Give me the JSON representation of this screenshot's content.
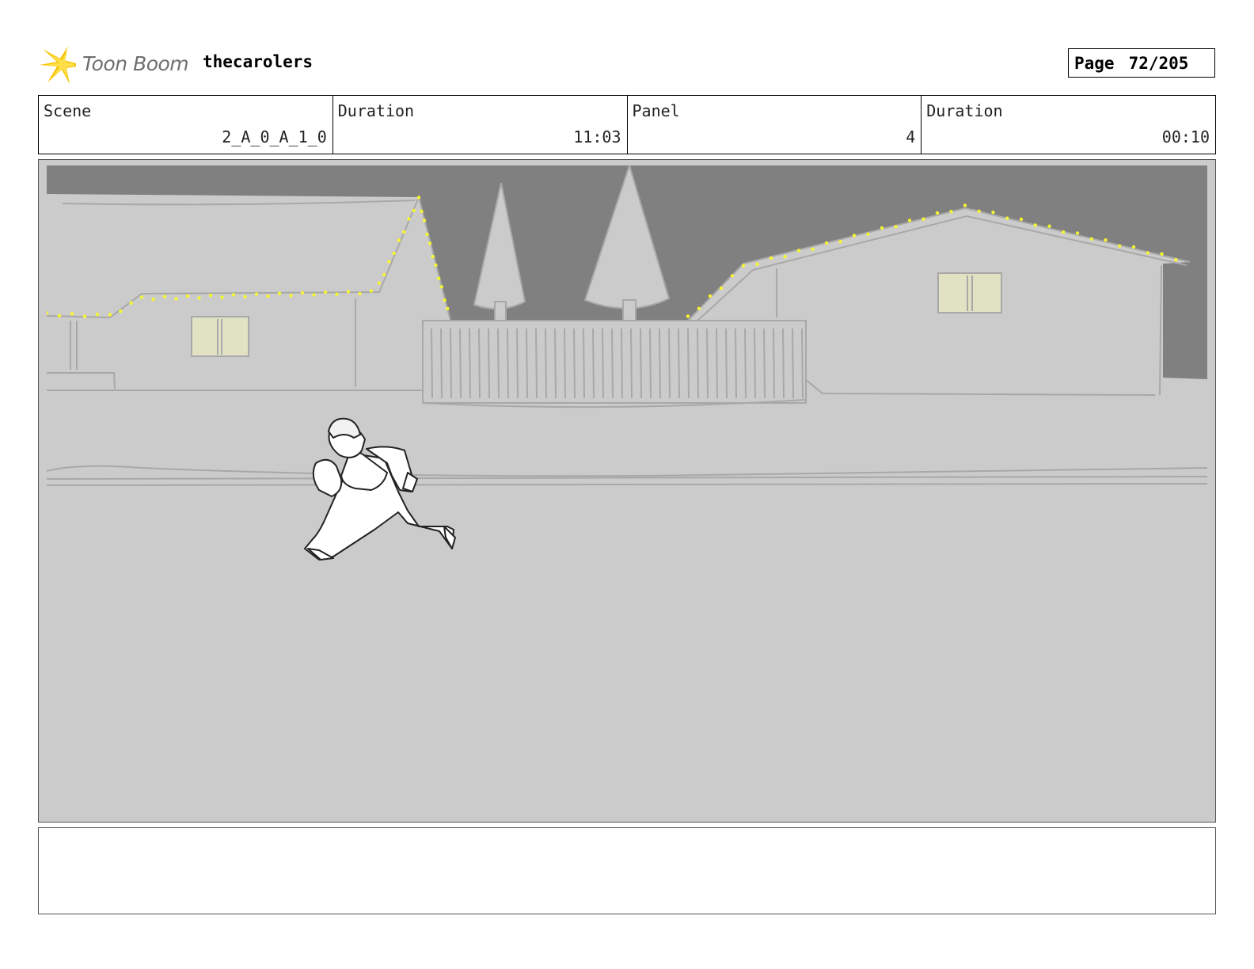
{
  "header": {
    "logo_text": "Toon Boom",
    "project_title": "thecarolers",
    "page_label": "Page",
    "page_number": "72/205"
  },
  "info": {
    "scene_label": "Scene",
    "scene_value": "2_A_0_A_1_0",
    "scene_duration_label": "Duration",
    "scene_duration_value": "11:03",
    "panel_label": "Panel",
    "panel_value": "4",
    "panel_duration_label": "Duration",
    "panel_duration_value": "00:10"
  },
  "notes": {
    "text": ""
  },
  "colors": {
    "sky": "#808080",
    "ground": "#cbcbcb",
    "lights": "#f5f532",
    "window": "#e1e1c3",
    "logo_star": "#f5c400"
  }
}
